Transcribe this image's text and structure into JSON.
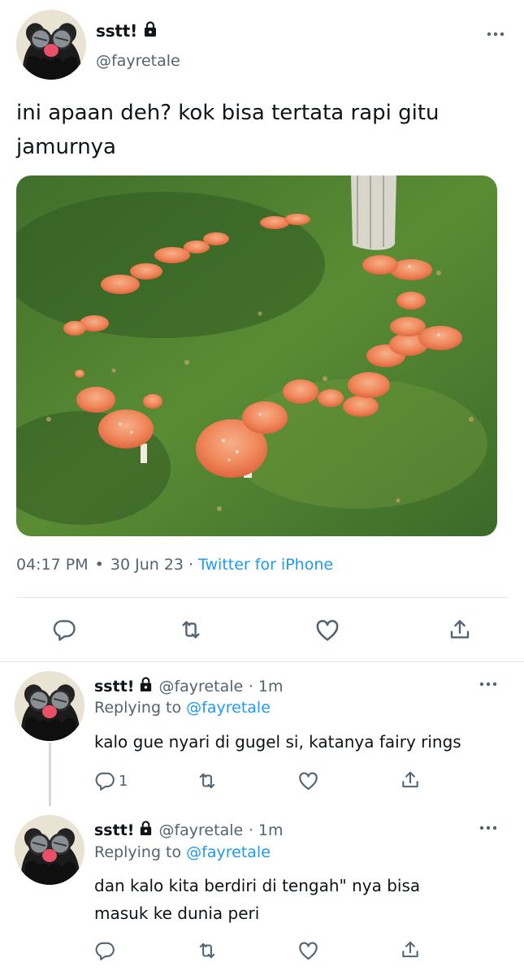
{
  "main_tweet": {
    "display_name": "sstt!",
    "handle": "@fayretale",
    "text_line1": "ini apaan deh? kok bisa tertata rapi gitu",
    "text_line2": "jamurnya",
    "time": "04:17 PM",
    "dot": "•",
    "date": "30 Jun 23",
    "date_sep": "·",
    "source": "Twitter for iPhone",
    "actions": [
      "reply-icon",
      "retweet-icon",
      "like-icon",
      "share-icon"
    ]
  },
  "replies": [
    {
      "display_name": "sstt!",
      "handle": "@fayretale",
      "time": "· 1m",
      "replying_label": "Replying to",
      "replying_mention": "@fayretale",
      "text_line1": "kalo gue nyari di gugel si, katanya fairy rings",
      "text_line2": "",
      "reply_count": "1"
    },
    {
      "display_name": "sstt!",
      "handle": "@fayretale",
      "time": "· 1m",
      "replying_label": "Replying to",
      "replying_mention": "@fayretale",
      "text_line1": "dan kalo kita berdiri di tengah\" nya bisa",
      "text_line2": "masuk ke dunia peri",
      "reply_count": ""
    }
  ],
  "colors": {
    "accent": "#1d9bf0",
    "secondary_text": "#536471",
    "primary_text": "#0f1419",
    "divider": "#e1e6ea",
    "mushroom_cap": "#f08a5d",
    "grass": "#4a7a2e"
  }
}
